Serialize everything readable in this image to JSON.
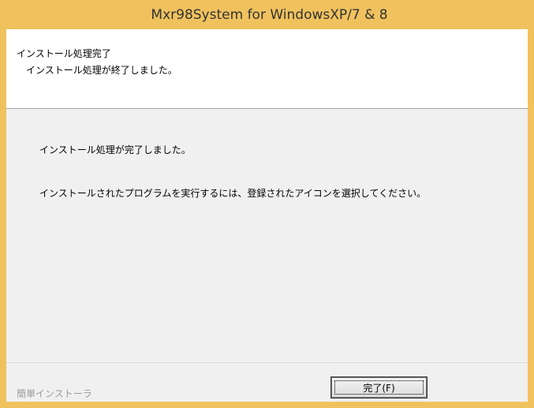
{
  "window": {
    "title": "Mxr98System for WindowsXP/7 & 8",
    "frame_color": "#f0c25e"
  },
  "header": {
    "title": "インストール処理完了",
    "subtitle": "インストール処理が終了しました。"
  },
  "body": {
    "message_1": "インストール処理が完了しました。",
    "message_2": "インストールされたプログラムを実行するには、登録されたアイコンを選択してください。"
  },
  "footer": {
    "label": "簡単インストーラ",
    "finish_label": "完了(F)"
  }
}
